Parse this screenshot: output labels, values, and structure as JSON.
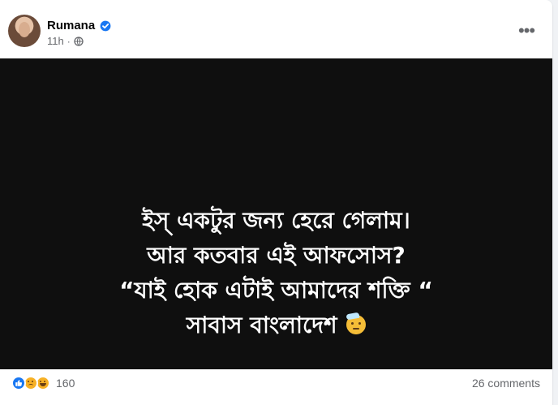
{
  "post": {
    "author": {
      "name": "Rumana",
      "verified_icon": "verified-badge-icon",
      "time": "11h",
      "separator": "·",
      "audience_icon": "globe-icon"
    },
    "menu_icon": "more-options-icon",
    "media": {
      "background": "#0f0f0f",
      "text_color": "#ffffff",
      "lines": [
        "ইস্ একটুর জন্য হেরে গেলাম।",
        "আর কতবার এই আফসোস?",
        "“যাই হোক এটাই আমাদের শক্তি “",
        "সাবাস বাংলাদেশ"
      ],
      "emoji": "saluting-face-emoji"
    },
    "footer": {
      "reaction_icons": [
        "like-icon",
        "sad-icon",
        "haha-icon"
      ],
      "reaction_count": "160",
      "comments_text": "26 comments"
    }
  }
}
